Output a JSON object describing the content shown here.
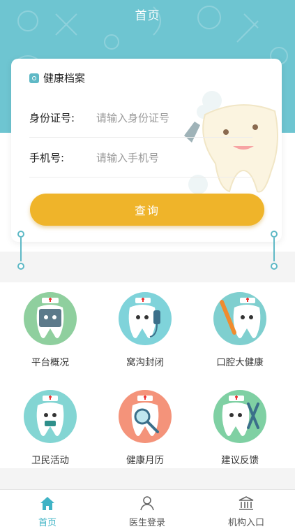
{
  "header": {
    "title": "首页"
  },
  "card": {
    "title": "健康档案",
    "id_label": "身份证号:",
    "id_placeholder": "请输入身份证号",
    "phone_label": "手机号:",
    "phone_placeholder": "请输入手机号",
    "query_button": "查询"
  },
  "grid": [
    {
      "label": "平台概况",
      "color": "#8fcf9e",
      "icon": "tooth-tablet-icon"
    },
    {
      "label": "窝沟封闭",
      "color": "#7fd3da",
      "icon": "tooth-drill-icon"
    },
    {
      "label": "口腔大健康",
      "color": "#7fcfcf",
      "icon": "tooth-brush-icon"
    },
    {
      "label": "卫民活动",
      "color": "#83d5d3",
      "icon": "tooth-activity-icon"
    },
    {
      "label": "健康月历",
      "color": "#f4937a",
      "icon": "tooth-magnifier-icon"
    },
    {
      "label": "建议反馈",
      "color": "#7fd0a3",
      "icon": "tooth-wrench-icon"
    }
  ],
  "tabs": [
    {
      "label": "首页",
      "icon": "home-icon",
      "active": true
    },
    {
      "label": "医生登录",
      "icon": "user-icon",
      "active": false
    },
    {
      "label": "机构入口",
      "icon": "institution-icon",
      "active": false
    }
  ],
  "colors": {
    "accent": "#3fb3c5",
    "header": "#6ec5d1",
    "button": "#efb42a"
  }
}
